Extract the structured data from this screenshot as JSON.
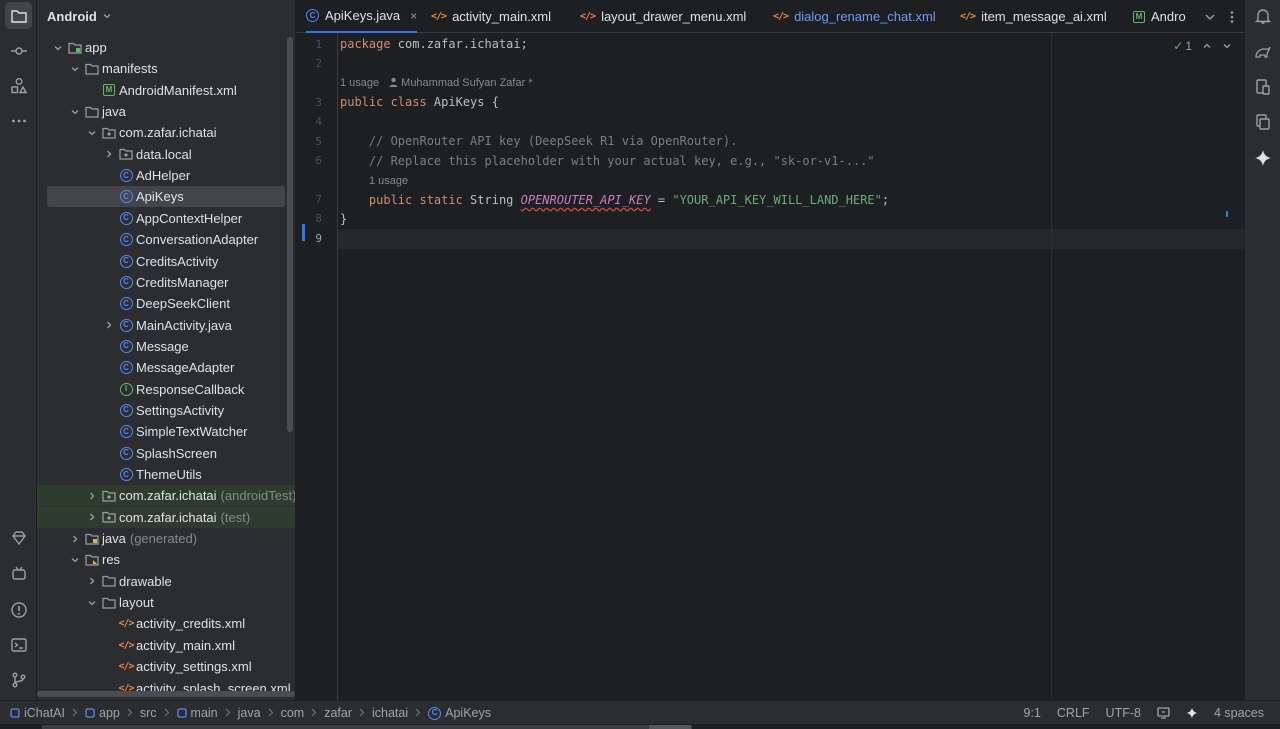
{
  "project_panel": {
    "title": "Android",
    "tree": [
      {
        "label": "app",
        "muted": "",
        "icon": "module-folder-icon",
        "indent": 0,
        "toggle": "open"
      },
      {
        "label": "manifests",
        "muted": "",
        "icon": "folder-icon",
        "indent": 1,
        "toggle": "open"
      },
      {
        "label": "AndroidManifest.xml",
        "muted": "",
        "icon": "manifest-icon",
        "indent": 2,
        "toggle": "none"
      },
      {
        "label": "java",
        "muted": "",
        "icon": "folder-icon",
        "indent": 1,
        "toggle": "open"
      },
      {
        "label": "com.zafar.ichatai",
        "muted": "",
        "icon": "package-icon",
        "indent": 2,
        "toggle": "open"
      },
      {
        "label": "data.local",
        "muted": "",
        "icon": "package-icon",
        "indent": 3,
        "toggle": "closed"
      },
      {
        "label": "AdHelper",
        "muted": "",
        "icon": "class-icon",
        "indent": 3,
        "toggle": "none"
      },
      {
        "label": "ApiKeys",
        "muted": "",
        "icon": "class-icon",
        "indent": 3,
        "toggle": "none",
        "selected": true
      },
      {
        "label": "AppContextHelper",
        "muted": "",
        "icon": "class-icon",
        "indent": 3,
        "toggle": "none"
      },
      {
        "label": "ConversationAdapter",
        "muted": "",
        "icon": "class-icon",
        "indent": 3,
        "toggle": "none"
      },
      {
        "label": "CreditsActivity",
        "muted": "",
        "icon": "class-icon",
        "indent": 3,
        "toggle": "none"
      },
      {
        "label": "CreditsManager",
        "muted": "",
        "icon": "class-icon",
        "indent": 3,
        "toggle": "none"
      },
      {
        "label": "DeepSeekClient",
        "muted": "",
        "icon": "class-icon",
        "indent": 3,
        "toggle": "none"
      },
      {
        "label": "MainActivity.java",
        "muted": "",
        "icon": "class-icon",
        "indent": 3,
        "toggle": "closed"
      },
      {
        "label": "Message",
        "muted": "",
        "icon": "class-icon",
        "indent": 3,
        "toggle": "none"
      },
      {
        "label": "MessageAdapter",
        "muted": "",
        "icon": "class-icon",
        "indent": 3,
        "toggle": "none"
      },
      {
        "label": "ResponseCallback",
        "muted": "",
        "icon": "interface-icon",
        "indent": 3,
        "toggle": "none"
      },
      {
        "label": "SettingsActivity",
        "muted": "",
        "icon": "class-icon",
        "indent": 3,
        "toggle": "none"
      },
      {
        "label": "SimpleTextWatcher",
        "muted": "",
        "icon": "class-icon",
        "indent": 3,
        "toggle": "none"
      },
      {
        "label": "SplashScreen",
        "muted": "",
        "icon": "class-icon",
        "indent": 3,
        "toggle": "none"
      },
      {
        "label": "ThemeUtils",
        "muted": "",
        "icon": "class-icon",
        "indent": 3,
        "toggle": "none"
      },
      {
        "label": "com.zafar.ichatai",
        "muted": "(androidTest)",
        "icon": "package-icon",
        "indent": 2,
        "toggle": "closed",
        "green": true
      },
      {
        "label": "com.zafar.ichatai",
        "muted": "(test)",
        "icon": "package-icon",
        "indent": 2,
        "toggle": "closed",
        "green": true
      },
      {
        "label": "java",
        "muted": "(generated)",
        "icon": "generated-folder-icon",
        "indent": 1,
        "toggle": "closed"
      },
      {
        "label": "res",
        "muted": "",
        "icon": "res-folder-icon",
        "indent": 1,
        "toggle": "open"
      },
      {
        "label": "drawable",
        "muted": "",
        "icon": "folder-icon",
        "indent": 2,
        "toggle": "closed"
      },
      {
        "label": "layout",
        "muted": "",
        "icon": "folder-icon",
        "indent": 2,
        "toggle": "open"
      },
      {
        "label": "activity_credits.xml",
        "muted": "",
        "icon": "xml-icon",
        "indent": 3,
        "toggle": "none"
      },
      {
        "label": "activity_main.xml",
        "muted": "",
        "icon": "xml-icon",
        "indent": 3,
        "toggle": "none"
      },
      {
        "label": "activity_settings.xml",
        "muted": "",
        "icon": "xml-icon",
        "indent": 3,
        "toggle": "none"
      },
      {
        "label": "activity_splash_screen.xml",
        "muted": "",
        "icon": "xml-icon",
        "indent": 3,
        "toggle": "none"
      }
    ]
  },
  "tabs": [
    {
      "label": "ApiKeys.java",
      "icon": "class-icon",
      "active": true,
      "close": "×"
    },
    {
      "label": "activity_main.xml",
      "icon": "xml-icon"
    },
    {
      "label": "layout_drawer_menu.xml",
      "icon": "xml-icon"
    },
    {
      "label": "dialog_rename_chat.xml",
      "icon": "xml-icon",
      "highlight": true
    },
    {
      "label": "item_message_ai.xml",
      "icon": "xml-icon"
    },
    {
      "label": "Andro",
      "icon": "manifest-icon"
    }
  ],
  "editor": {
    "line_numbers": [
      "1",
      "2",
      "3",
      "4",
      "5",
      "6",
      "7",
      "8",
      "9"
    ],
    "current_line": "9",
    "hints": {
      "usage_1": "1 usage",
      "author": "Muhammad Sufyan Zafar *",
      "usage_2": "1 usage"
    },
    "code": {
      "l1_kw": "package",
      "l1_rest": " com.zafar.ichatai;",
      "l3_kw": "public class",
      "l3_rest": " ApiKeys {",
      "l5": "    // OpenRouter API key (DeepSeek R1 via OpenRouter).",
      "l6": "    // Replace this placeholder with your actual key, e.g., \"sk-or-v1-...\"",
      "l7_indent": "    ",
      "l7_kw": "public static",
      "l7_type": " String ",
      "l7_const": "OPENROUTER_API_KEY",
      "l7_eq": " = ",
      "l7_str": "\"YOUR_API_KEY_WILL_LAND_HERE\"",
      "l7_end": ";",
      "l8": "}"
    },
    "inspection_count": "1"
  },
  "status_bar": {
    "breadcrumbs": [
      "iChatAI",
      "app",
      "src",
      "main",
      "java",
      "com",
      "zafar",
      "ichatai",
      "ApiKeys"
    ],
    "position": "9:1",
    "line_ending": "CRLF",
    "encoding": "UTF-8",
    "indent": "4 spaces"
  },
  "colors": {
    "accent": "#3574f0",
    "keyword": "#cf8e6d",
    "string": "#6aab73",
    "comment": "#7a7e85",
    "constant": "#c77dbb"
  }
}
